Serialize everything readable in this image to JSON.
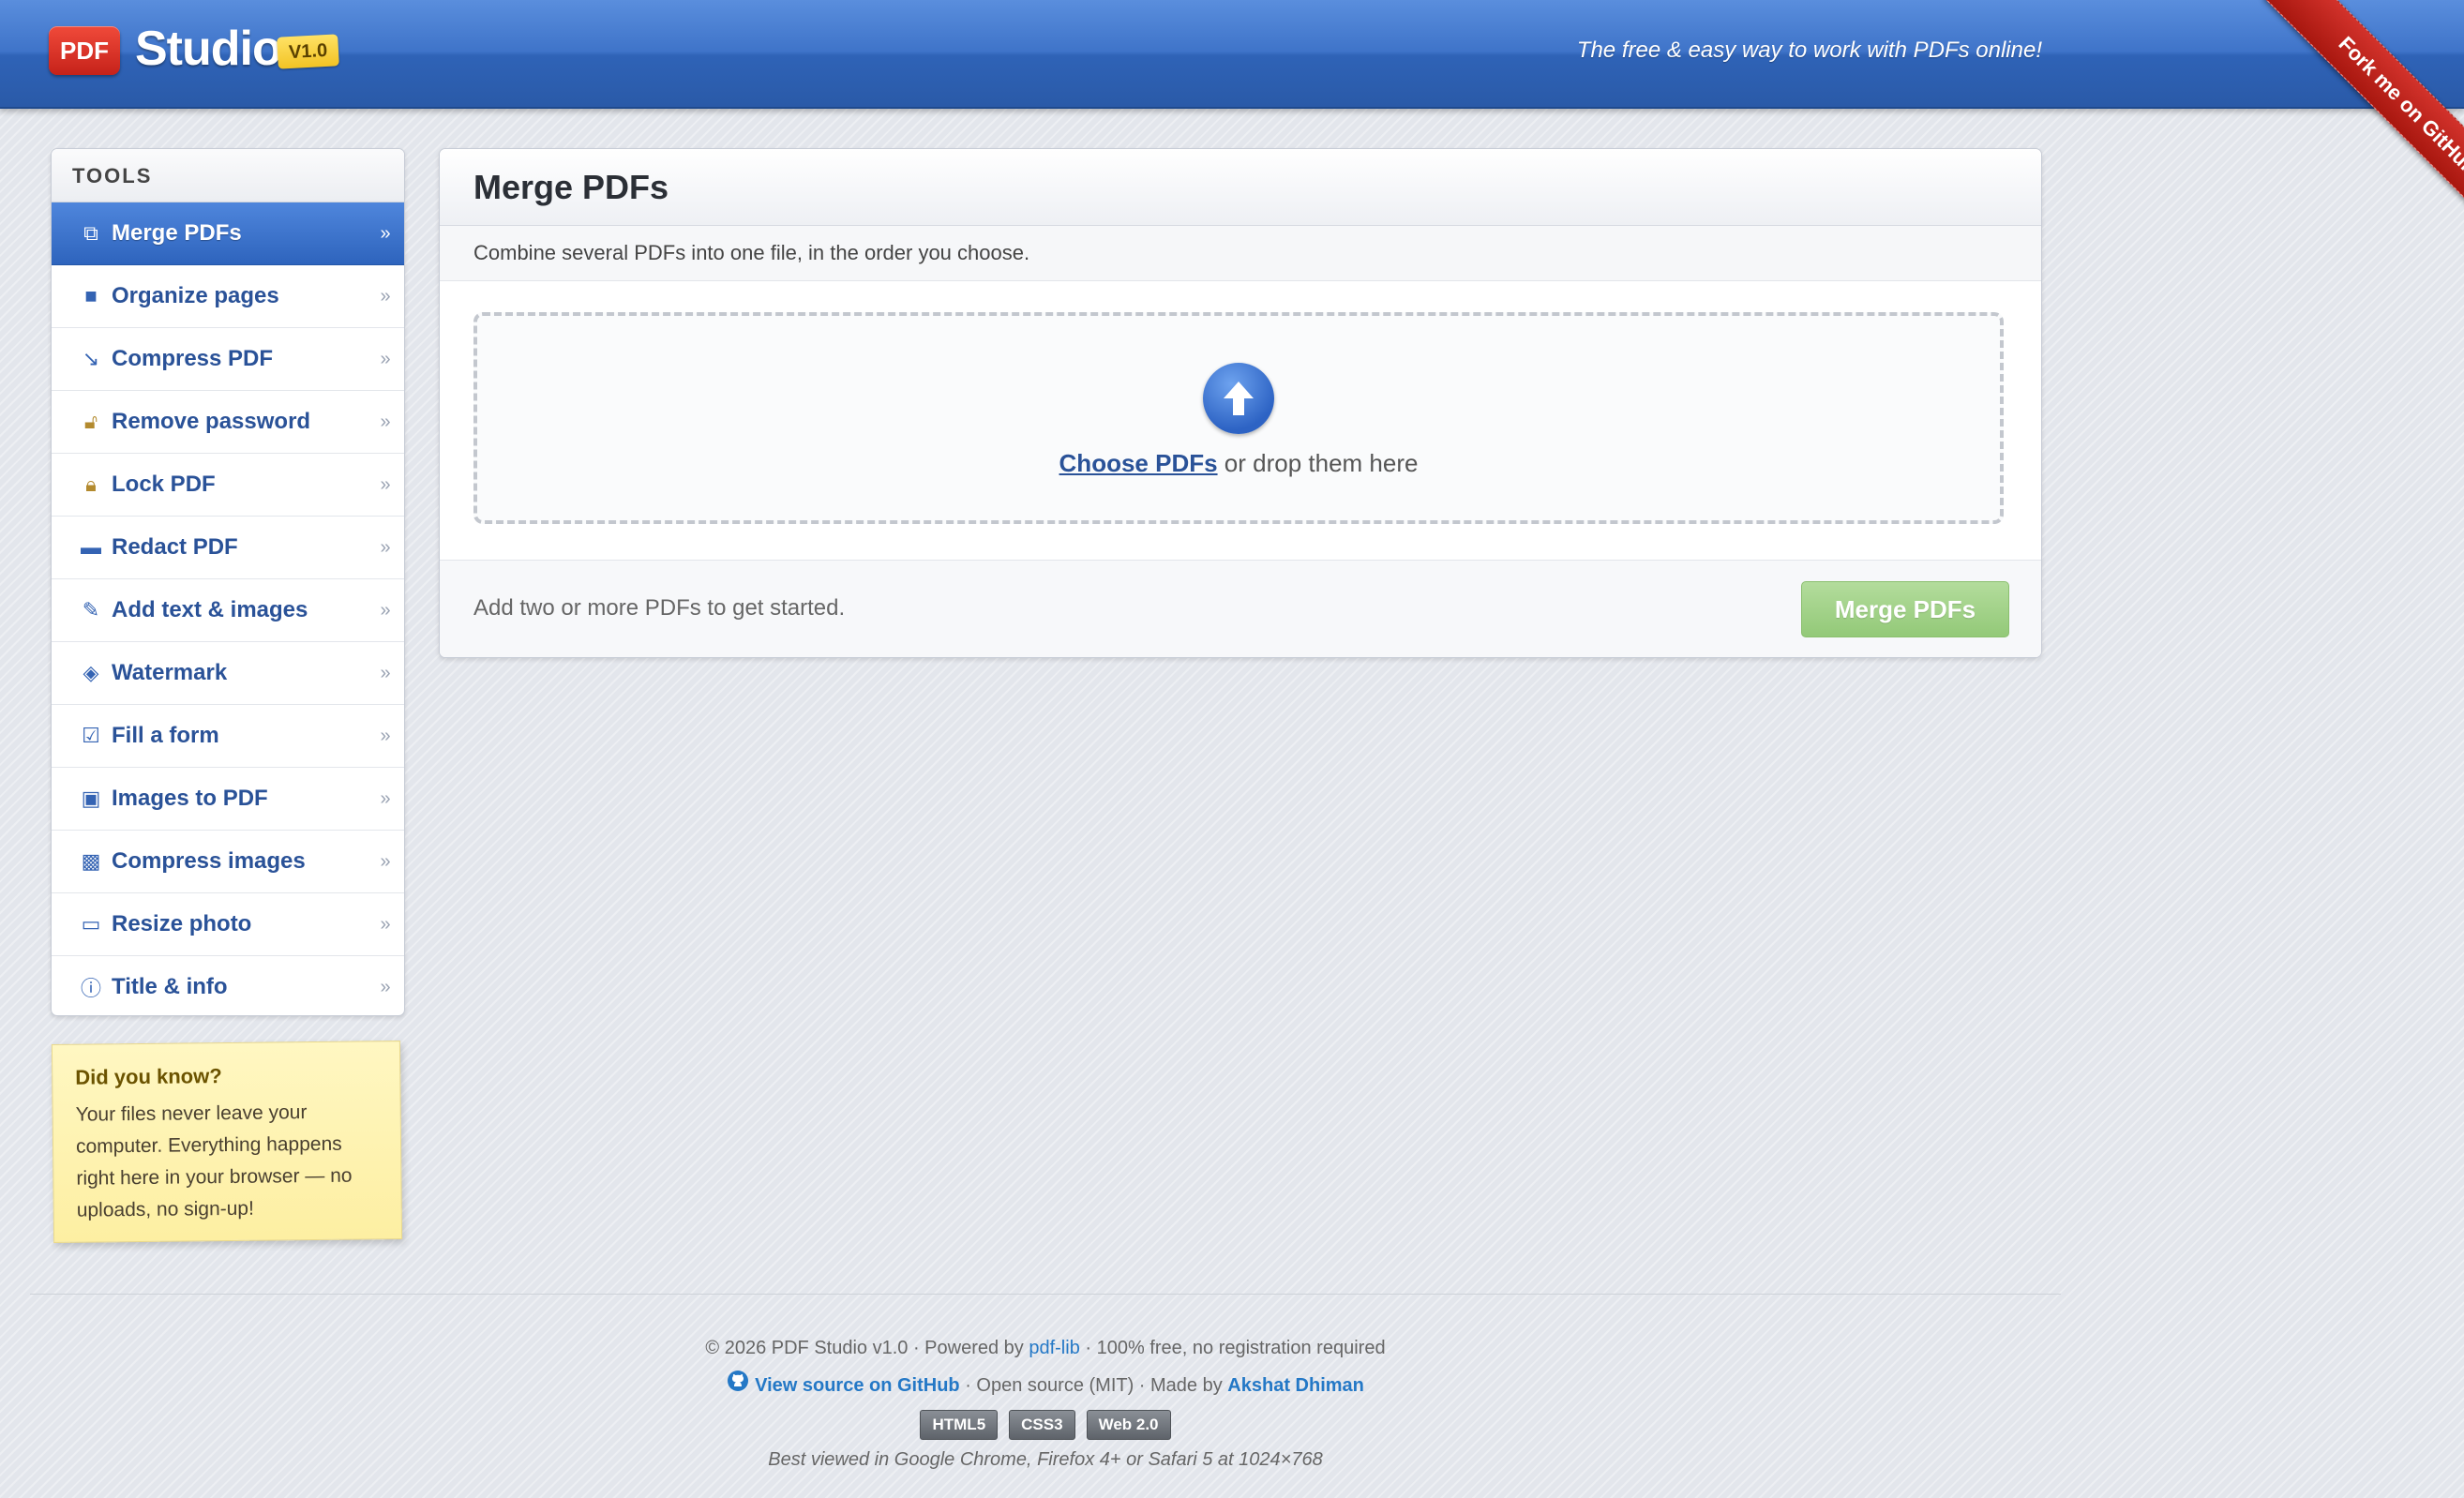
{
  "header": {
    "logo_pdf": "PDF",
    "logo_name": "Studio",
    "version": "V1.0",
    "tagline": "The free & easy way to work with PDFs online!",
    "ribbon": "Fork me on GitHub"
  },
  "sidebar": {
    "title": "TOOLS",
    "items": [
      {
        "label": "Merge PDFs",
        "icon": "merge-icon",
        "active": true
      },
      {
        "label": "Organize pages",
        "icon": "organize-icon"
      },
      {
        "label": "Compress PDF",
        "icon": "compress-icon"
      },
      {
        "label": "Remove password",
        "icon": "unlock-icon"
      },
      {
        "label": "Lock PDF",
        "icon": "lock-icon"
      },
      {
        "label": "Redact PDF",
        "icon": "redact-icon"
      },
      {
        "label": "Add text & images",
        "icon": "pencil-icon"
      },
      {
        "label": "Watermark",
        "icon": "diamond-icon"
      },
      {
        "label": "Fill a form",
        "icon": "checkbox-icon"
      },
      {
        "label": "Images to PDF",
        "icon": "image-icon"
      },
      {
        "label": "Compress images",
        "icon": "compress-images-icon"
      },
      {
        "label": "Resize photo",
        "icon": "resize-icon"
      },
      {
        "label": "Title & info",
        "icon": "info-icon"
      }
    ],
    "arrow": "»"
  },
  "note": {
    "title": "Did you know?",
    "body": "Your files never leave your computer. Everything happens right here in your browser — no uploads, no sign-up!"
  },
  "main": {
    "title": "Merge PDFs",
    "description": "Combine several PDFs into one file, in the order you choose.",
    "choose_link": "Choose PDFs",
    "drop_text": " or drop them here",
    "hint": "Add two or more PDFs to get started.",
    "merge_button": "Merge PDFs"
  },
  "footer": {
    "copyright": "© 2026 PDF Studio v1.0 · Powered by ",
    "powered_link": "pdf-lib",
    "free_text": " · 100% free, no registration required",
    "github_link": "View source on GitHub",
    "open_source": " · Open source (MIT) · Made by ",
    "author": "Akshat Dhiman",
    "badges": [
      "HTML5",
      "CSS3",
      "Web 2.0"
    ],
    "best_viewed": "Best viewed in Google Chrome, Firefox 4+ or Safari 5 at 1024×768"
  },
  "colors": {
    "header_blue": "#3f74c9",
    "link_blue": "#2a5298",
    "merge_button_green": "#a5d48a",
    "ribbon_red": "#c6221a"
  }
}
